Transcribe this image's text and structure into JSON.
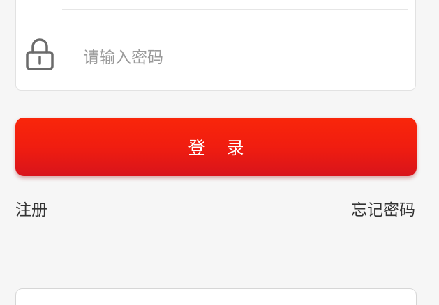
{
  "login_form": {
    "username": {
      "value": "",
      "icon": "user-icon"
    },
    "password": {
      "value": "",
      "placeholder": "请输入密码",
      "icon": "lock-icon"
    }
  },
  "login_button": {
    "label": "登录"
  },
  "links": {
    "register_label": "注册",
    "forgot_password_label": "忘记密码"
  },
  "colors": {
    "accent": "#f01d10",
    "background": "#f6f6f6",
    "icon_gray": "#6b6b6b"
  }
}
